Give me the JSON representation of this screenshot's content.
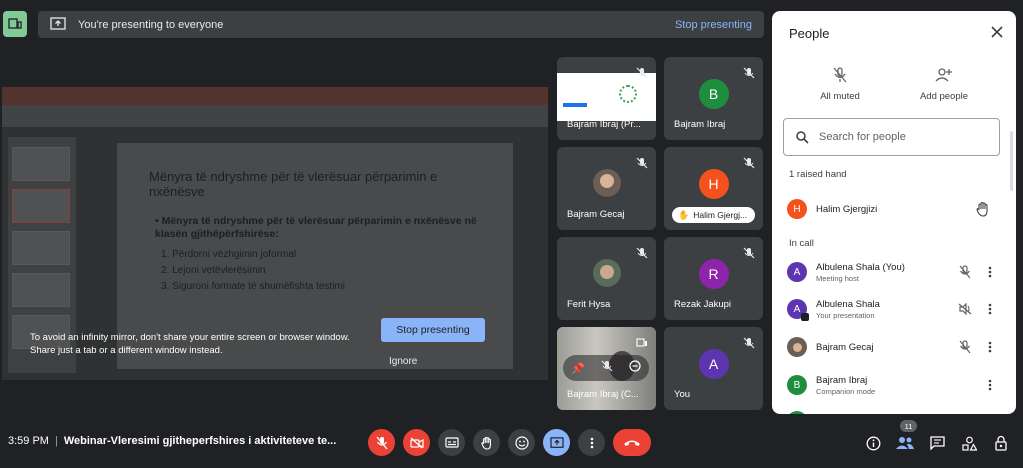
{
  "top": {
    "status_text": "You're presenting to everyone",
    "stop_label": "Stop presenting"
  },
  "stage": {
    "slide_title": "Mënyra të ndryshme për të vlerësuar përparimin e nxënësve",
    "slide_bullet": "• Mënyra të ndryshme për të vlerësuar përparimin e nxënësve në klasën gjithëpërfshirëse:",
    "slide_items": [
      "1. Përdorni vëzhgimin joformal",
      "2. Lejoni vetëvlerësimin",
      "3. Siguroni formate të shumëfishta testimi"
    ],
    "mirror_warning": "To avoid an infinity mirror, don't share your entire screen or browser window. Share just a tab or a different window instead.",
    "stop_button": "Stop presenting",
    "ignore_button": "Ignore"
  },
  "tiles": [
    {
      "name": "Bajram Ibraj (Pr...",
      "kind": "screen"
    },
    {
      "name": "Bajram Ibraj",
      "initial": "B",
      "color": "#1e8e3e"
    },
    {
      "name": "Bajram Gecaj",
      "kind": "photo"
    },
    {
      "name": "Halim Gjergj...",
      "initial": "H",
      "color": "#f4511e"
    },
    {
      "name": "Ferit Hysa",
      "kind": "photo"
    },
    {
      "name": "Rezak Jakupi",
      "initial": "R",
      "color": "#8e24aa"
    },
    {
      "name": "Bajram Ibraj (C...",
      "kind": "photo"
    },
    {
      "name": "You",
      "initial": "A",
      "color": "#5e35b1"
    }
  ],
  "panel": {
    "title": "People",
    "all_muted": "All muted",
    "add_people": "Add people",
    "search_placeholder": "Search for people",
    "raised_section": "1 raised hand",
    "in_call_section": "In call",
    "raised": [
      {
        "name": "Halim Gjergjizi",
        "initial": "H",
        "color": "#f4511e"
      }
    ],
    "people": [
      {
        "name": "Albulena Shala (You)",
        "sub": "Meeting host",
        "initial": "A",
        "color": "#5e35b1"
      },
      {
        "name": "Albulena Shala",
        "sub": "Your presentation",
        "initial": "A",
        "color": "#5e35b1"
      },
      {
        "name": "Bajram Gecaj",
        "sub": "",
        "initial": "",
        "color": "#6b5e54"
      },
      {
        "name": "Bajram Ibraj",
        "sub": "Companion mode",
        "initial": "B",
        "color": "#1e8e3e"
      }
    ]
  },
  "bottom": {
    "time": "3:59 PM",
    "meeting_title": "Webinar-Vleresimi gjitheperfshires i aktiviteteve te...",
    "participant_count": "11"
  }
}
